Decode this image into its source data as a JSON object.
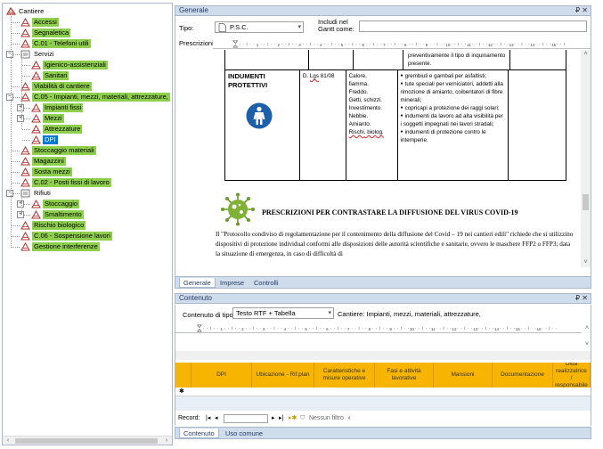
{
  "tree": {
    "root": "Cantiere",
    "items": [
      {
        "label": "Accessi"
      },
      {
        "label": "Segnaletica"
      },
      {
        "label": "C.01 - Telefoni utili"
      },
      {
        "label": "Servizi"
      },
      {
        "label": "Igienico-assistenziali"
      },
      {
        "label": "Sanitari"
      },
      {
        "label": "Viabilità di cantiere"
      },
      {
        "label": "C.05 - Impianti, mezzi, materiali, attrezzature,"
      },
      {
        "label": "Impianti fissi"
      },
      {
        "label": "Mezzi"
      },
      {
        "label": "Attrezzature"
      },
      {
        "label": "DPI"
      },
      {
        "label": "Stoccaggio materiali"
      },
      {
        "label": "Magazzini"
      },
      {
        "label": "Sosta mezzi"
      },
      {
        "label": "C.02 - Posti fissi di lavoro"
      },
      {
        "label": "Rifiuti"
      },
      {
        "label": "Stoccaggio"
      },
      {
        "label": "Smaltimento"
      },
      {
        "label": "Rischio biologico"
      },
      {
        "label": "C.06 - Sospensione lavori"
      },
      {
        "label": "Gestione interferenze"
      }
    ]
  },
  "generale": {
    "title": "Generale",
    "pin": "₽",
    "close": "✕",
    "tipo_label": "Tipo:",
    "tipo_value": "P.S.C.",
    "includi_label": "Includi nel Gantt come:",
    "prescrizioni_label": "Prescrizioni:",
    "doc": {
      "top_text": "preventivamente il tipo di inquinamento presente.",
      "ppe_title": "INDUMENTI PROTETTIVI",
      "law_prefix": "D. ",
      "law_word": "Lgs",
      "law_suffix": " 81/08",
      "risks": [
        "Calore,",
        "fiamma.",
        "Freddo.",
        "Getti, schizzi.",
        "Investimento.",
        "Nebbie.",
        "Amianto."
      ],
      "risk_last_a": "Rischi",
      "risk_last_b": ". biolog.",
      "bullets": [
        "grembiuli e gambali per asfaltisti;",
        "tute speciali per verniciatori, addetti alla rimozione di amianto, coibentatori di fibre minerali;",
        "copricapi a protezione dei raggi solari;",
        "indumenti da lavoro ad alta visibilità per i soggetti impegnati nei lavori stradali;",
        "indumenti di protezione contro le intemperie."
      ],
      "covid_title": "PRESCRIZIONI PER CONTRASTARE LA DIFFUSIONE DEL VIRUS COVID-19",
      "covid_para": "Il \"Protocollo condiviso di regolamentazione per il contenimento della diffusione del Covid – 19 nei cantieri edili\" richiede che si utilizzino dispositivi di protezione individual conformi alle disposizioni delle autorità scientifiche e sanitarie, ovvero le maschere FFP2 o FFP3; data la situazione di emergenza, in caso di difficoltà di"
    },
    "tabs": [
      "Generale",
      "Imprese",
      "Controlli"
    ]
  },
  "contenuto": {
    "title": "Contenuto",
    "tipo_label": "Contenuto di tipo:",
    "tipo_value": "Testo RTF + Tabella",
    "cantiere_text": "Cantiere: Impianti, mezzi, materiali, attrezzature,",
    "columns": [
      "DPI",
      "Ubicazione - Rif.plan",
      "Caratteristiche e misure operative",
      "Fasi e attività lavorative",
      "Mansioni",
      "Documentazione",
      "Ditta realizzatrice / responsabile"
    ],
    "record_label": "Record:",
    "nessun_filtro": "Nessun filtro",
    "tabs": [
      "Contenuto",
      "Uso comune"
    ]
  },
  "colors": {
    "tree_highlight": "#8fcf4e",
    "selection": "#0078d7",
    "grid_header": "#f7b400",
    "panel_title": "#cfdcec"
  }
}
